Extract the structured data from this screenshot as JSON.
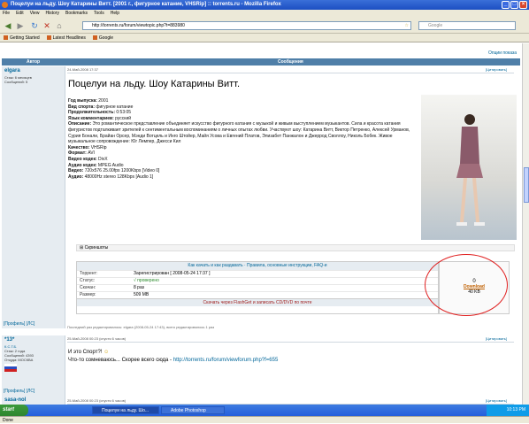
{
  "window": {
    "title": "Поцелуи на льду. Шоу Катарины Витт. [2001 г., фигурное катание, VHSRip] :: torrents.ru - Mozilla Firefox"
  },
  "menu": [
    "File",
    "Edit",
    "View",
    "History",
    "Bookmarks",
    "Tools",
    "Help"
  ],
  "nav": {
    "url": "http://torrents.ru/forum/viewtopic.php?t=883980",
    "search_placeholder": "Google"
  },
  "bookmarks": [
    "Getting Started",
    "Latest Headlines",
    "Google"
  ],
  "page": {
    "top_link": "Опции показа",
    "col_author": "Автор",
    "col_message": "Сообщения",
    "post1": {
      "author": "elgara",
      "rank": "Стаж: 6 месяцев",
      "msgs": "Сообщений: 5",
      "date": "24-Май-2008 17:37",
      "quote": "[Цитировать]",
      "title": "Поцелуи на льду. Шоу Катарины Витт.",
      "year_label": "Год выпуска:",
      "year": "2001",
      "sport_label": "Вид спорта:",
      "sport": "фигурное катание",
      "duration_label": "Продолжительность:",
      "duration": "0:53:05",
      "lang_label": "Язык комментариев:",
      "lang": "русский",
      "desc_label": "Описание:",
      "desc": "Это романтическое представление объединяет искусство фигурного катания с музыкой и живым выступлением музыкантов. Сила и красота катания фигуристов подталкивает зрителей к сентиментальным воспоминаниям о личных опытах любви. Участвуют шоу: Катарина Витт, Виктор Петренко, Алексей Урманов, Сурия Бонали, Брайан Орсер, Мэнди Вотцель и Инго Штойер, Майя Усова и Евгений Платов, Элизабет Панжалон и Джеррод Своллоу, Николь Бобек. Живое музыкальное сопровождение: Юг Лемпер, Джесси Кил",
      "quality_label": "Качество:",
      "quality": "VHSRip",
      "format_label": "Формат:",
      "format": "AVI",
      "vcodec_label": "Видео кодек:",
      "vcodec": "DivX",
      "acodec_label": "Аудио кодек:",
      "acodec": "MPEG Audio",
      "video_label": "Видео:",
      "video": "720x576 25.00fps 1200Kbps [Video 0]",
      "audio_label": "Аудио:",
      "audio": "48000Hz stereo 128Kbps [Audio 1]",
      "screens": "⊞ Скриншоты",
      "howto": "Как качать и как раздавать",
      "rules": "Правила, основные инструкции, FAQ-и",
      "torrent_label": "Торрент:",
      "torrent": "Зарегистрирован  [ 2008-05-24 17:37 ]",
      "status_label": "Статус:",
      "status": "√ проверено",
      "downloaded_label": "Скачан:",
      "downloaded": "8 раз",
      "size_label": "Размер:",
      "size": "509 MB",
      "burn": "Скачать через FlashGet и записать CD/DVD по почте",
      "dl_count": "0",
      "dl_btn": "Download",
      "dl_size": "40 KB",
      "edited": "Последний раз редактировалось: elgara (2008-05-24 17:43), всего редактировалось 1 раз",
      "profile": "[Профиль]  [ЛС]"
    },
    "post2": {
      "author": "*13*",
      "sub": "К.С.Т.Б.",
      "rank": "Стаж: 2 года",
      "msgs": "Сообщений: 4393",
      "city": "Откуда: МОСКВА",
      "date": "25-Май-2008 00:23",
      "ago": "(спустя 6 часов)",
      "quote": "[Цитировать]",
      "line1": "И это Спорт?!",
      "line2": "Что-то сомневаюсь... Скорее всего сюда -",
      "link": "http://torrents.ru/forum/viewforum.php?f=655",
      "profile": "[Профиль]  [ЛС]"
    },
    "post3": {
      "author": "sasa-nol",
      "date": "25-Май-2008 00:23",
      "ago": "(спустя 6 часов)",
      "quote": "[Цитировать]"
    }
  },
  "status": {
    "done": "Done"
  },
  "taskbar": {
    "start": "start",
    "items": [
      "Поцелуи на льду. Шо...",
      "Adobe Photoshop"
    ],
    "clock": "10:13 PM"
  }
}
